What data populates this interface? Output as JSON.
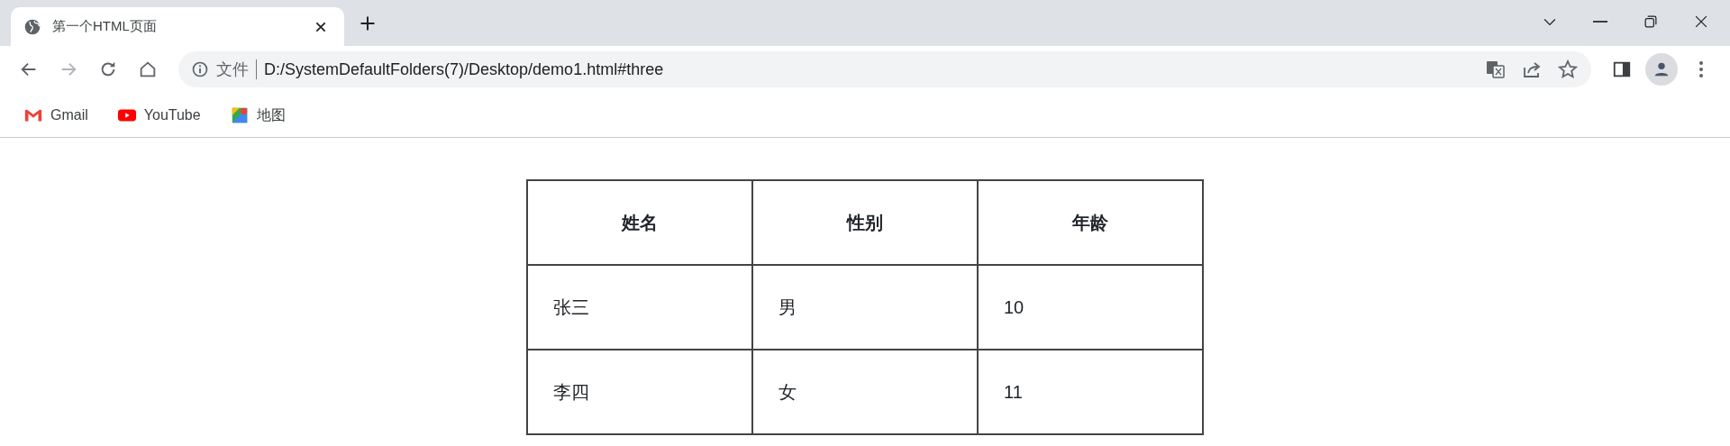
{
  "tab": {
    "title": "第一个HTML页面",
    "selected": true
  },
  "navigation": {
    "forward_disabled": true
  },
  "address_bar": {
    "security_label": "文件",
    "url": "D:/SystemDefaultFolders(7)/Desktop/demo1.html#three"
  },
  "bookmarks": [
    {
      "label": "Gmail",
      "kind": "gmail"
    },
    {
      "label": "YouTube",
      "kind": "youtube"
    },
    {
      "label": "地图",
      "kind": "maps"
    }
  ],
  "table": {
    "columns": [
      "姓名",
      "性别",
      "年龄"
    ],
    "rows": [
      [
        "张三",
        "男",
        "10"
      ],
      [
        "李四",
        "女",
        "11"
      ]
    ]
  }
}
